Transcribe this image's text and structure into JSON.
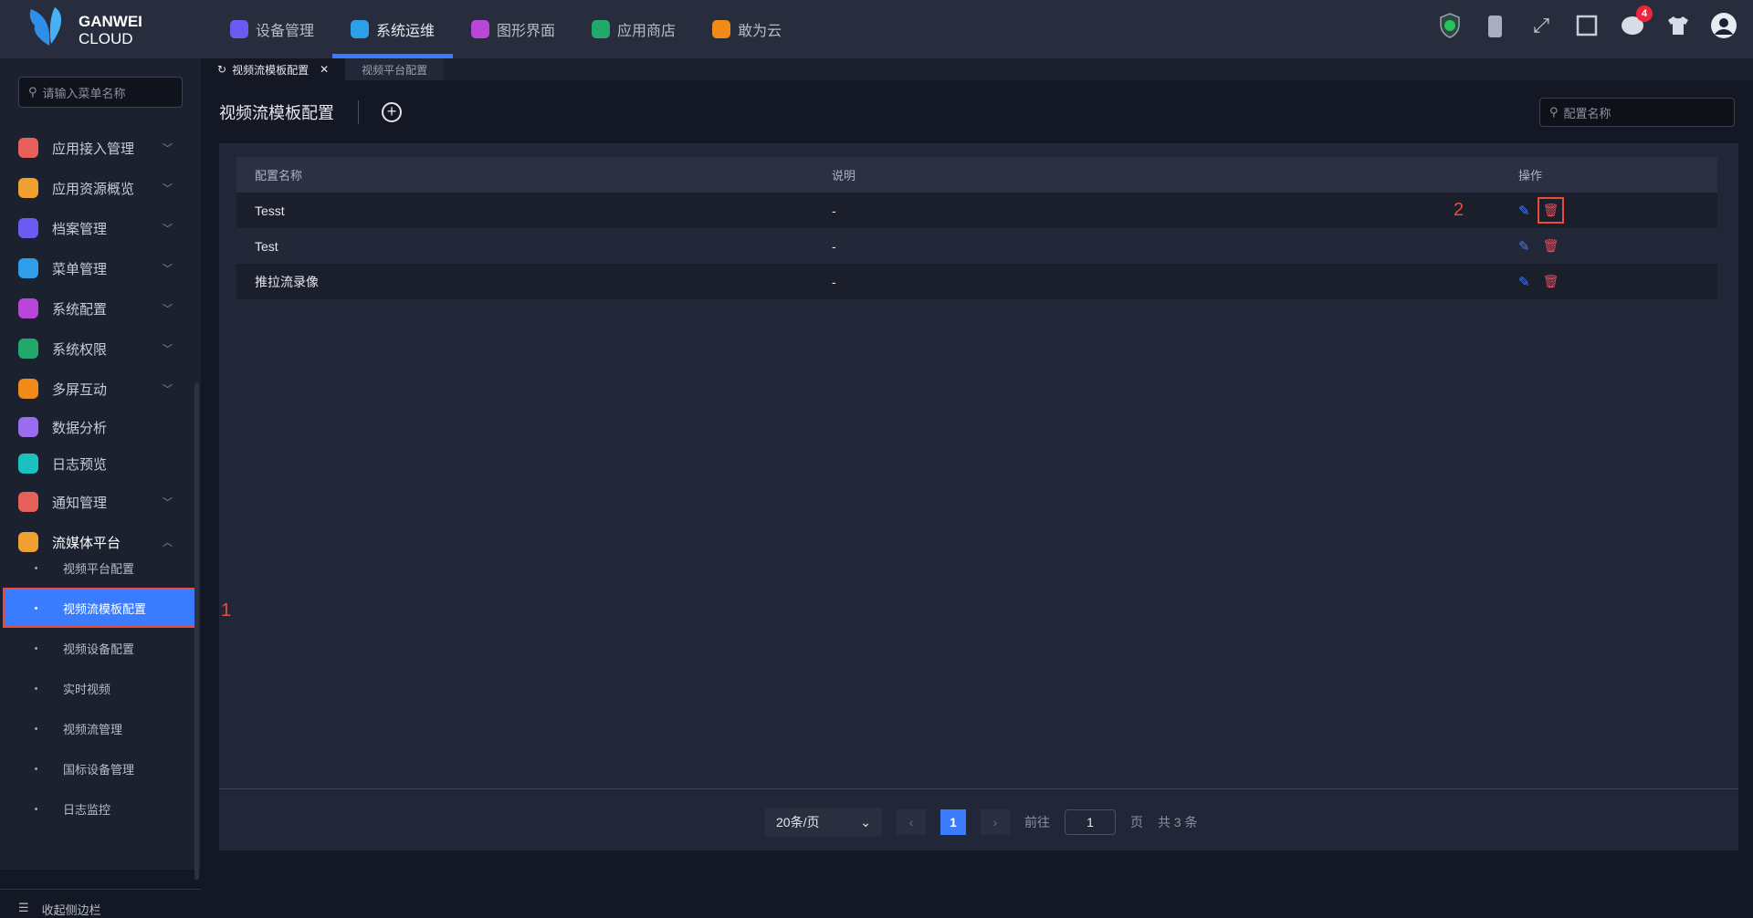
{
  "header": {
    "logo_line1": "GANWEI",
    "logo_line2": "CLOUD",
    "nav": [
      {
        "label": "设备管理",
        "color": "#6a5cf0"
      },
      {
        "label": "系统运维",
        "color": "#2f9ee8"
      },
      {
        "label": "图形界面",
        "color": "#b946d6"
      },
      {
        "label": "应用商店",
        "color": "#22a86a"
      },
      {
        "label": "敢为云",
        "color": "#f08a18"
      }
    ],
    "notification_count": "4"
  },
  "sidebar": {
    "search_placeholder": "请输入菜单名称",
    "items": [
      {
        "label": "应用接入管理",
        "color": "#e8605a"
      },
      {
        "label": "应用资源概览",
        "color": "#f0a030"
      },
      {
        "label": "档案管理",
        "color": "#6a5cf0"
      },
      {
        "label": "菜单管理",
        "color": "#2f9ee8"
      },
      {
        "label": "系统配置",
        "color": "#b946d6"
      },
      {
        "label": "系统权限",
        "color": "#22a86a"
      },
      {
        "label": "多屏互动",
        "color": "#f08a18"
      },
      {
        "label": "数据分析",
        "color": "#9a6cf0"
      },
      {
        "label": "日志预览",
        "color": "#1cc0c0"
      },
      {
        "label": "通知管理",
        "color": "#e8605a"
      },
      {
        "label": "流媒体平台",
        "color": "#f0a030"
      }
    ],
    "sub_items": [
      "视频平台配置",
      "视频流模板配置",
      "视频设备配置",
      "实时视频",
      "视频流管理",
      "国标设备管理",
      "日志监控"
    ],
    "collapse_label": "收起侧边栏"
  },
  "tabs": [
    "视频流模板配置",
    "视频平台配置"
  ],
  "page": {
    "title": "视频流模板配置",
    "search_placeholder": "配置名称"
  },
  "table": {
    "headers": [
      "配置名称",
      "说明",
      "操作"
    ],
    "rows": [
      {
        "name": "Tesst",
        "desc": "-"
      },
      {
        "name": "Test",
        "desc": "-"
      },
      {
        "name": "推拉流录像",
        "desc": "-"
      }
    ]
  },
  "annotations": [
    "1",
    "2"
  ],
  "pagination": {
    "page_size": "20条/页",
    "current": "1",
    "goto_label": "前往",
    "goto_value": "1",
    "page_unit": "页",
    "total": "共 3 条"
  }
}
